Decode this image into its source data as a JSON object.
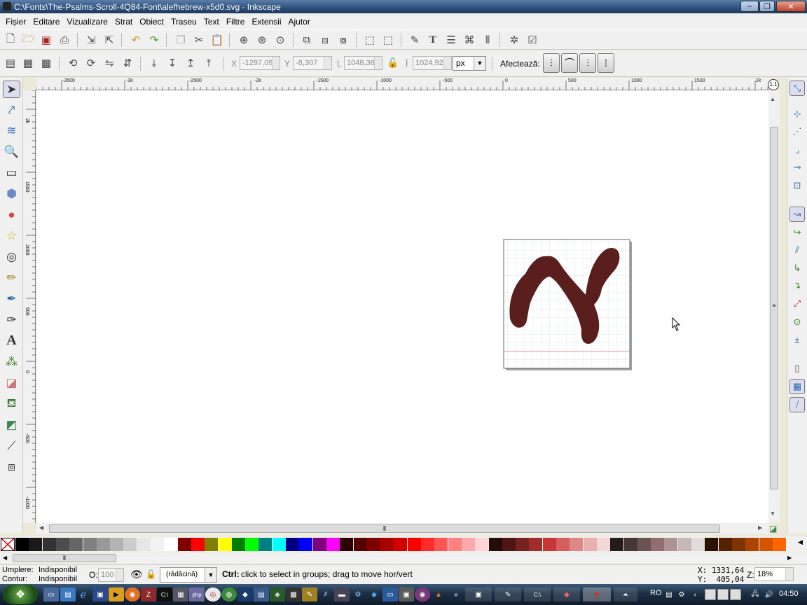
{
  "window": {
    "title": "C:\\Fonts\\The-Psalms-Scroll-4Q84-Font\\alefhebrew-x5d0.svg - Inkscape"
  },
  "menu": [
    "Fișier",
    "Editare",
    "Vizualizare",
    "Strat",
    "Obiect",
    "Traseu",
    "Text",
    "Filtre",
    "Extensii",
    "Ajutor"
  ],
  "controls": {
    "x_label": "X",
    "x_value": "-1297,09",
    "y_label": "Y",
    "y_value": "-8,307",
    "w_label": "L",
    "w_value": "1048,38",
    "h_label": "Î",
    "h_value": "1024,92",
    "unit": "px",
    "affect_label": "Afectează:"
  },
  "ruler": {
    "h_ticks": [
      "-3500",
      "-3k",
      "-2500",
      "-2k",
      "-1500",
      "-1000",
      "-500",
      "0",
      "500",
      "1000",
      "1500",
      "2k"
    ],
    "v_ticks": [
      "2k",
      "1500",
      "1000",
      "500",
      "0",
      "-500",
      "-1000"
    ]
  },
  "colors": {
    "glyph": "#5a1f1c",
    "palette": [
      "#000000",
      "#1a1a1a",
      "#333333",
      "#4d4d4d",
      "#666666",
      "#808080",
      "#999999",
      "#b3b3b3",
      "#cccccc",
      "#e6e6e6",
      "#f2f2f2",
      "#ffffff",
      "#800000",
      "#ff0000",
      "#808000",
      "#ffff00",
      "#008000",
      "#00ff00",
      "#008080",
      "#00ffff",
      "#000080",
      "#0000ff",
      "#800080",
      "#ff00ff",
      "#2b0000",
      "#550000",
      "#800000",
      "#aa0000",
      "#d40000",
      "#ff0000",
      "#ff2a2a",
      "#ff5555",
      "#ff8080",
      "#ffaaaa",
      "#ffd5d5",
      "#280b0b",
      "#501616",
      "#782121",
      "#a02c2c",
      "#c83737",
      "#d35f5f",
      "#de8787",
      "#e9afaf",
      "#f4d7d7",
      "#241c1c",
      "#483737",
      "#6c5353",
      "#916f6f",
      "#ac9393",
      "#c8b7b7",
      "#e3dbdb",
      "#2b1100",
      "#552200",
      "#803300",
      "#aa4400",
      "#d45500",
      "#ff6600"
    ]
  },
  "status": {
    "fill_label": "Umplere:",
    "fill_value": "Indisponibil",
    "stroke_label": "Contur:",
    "stroke_value": "Indisponibil",
    "opacity_label": "O:",
    "opacity_value": "100",
    "layer": "(rădăcină)",
    "message_key": "Ctrl:",
    "message": "click to select in groups; drag to move hor/vert",
    "cursor_x": "X: 1331,64",
    "cursor_y": "Y:  405,04",
    "zoom_label": "Z:",
    "zoom_value": "18%"
  },
  "taskbar": {
    "language": "RO",
    "clock": "04:50"
  }
}
